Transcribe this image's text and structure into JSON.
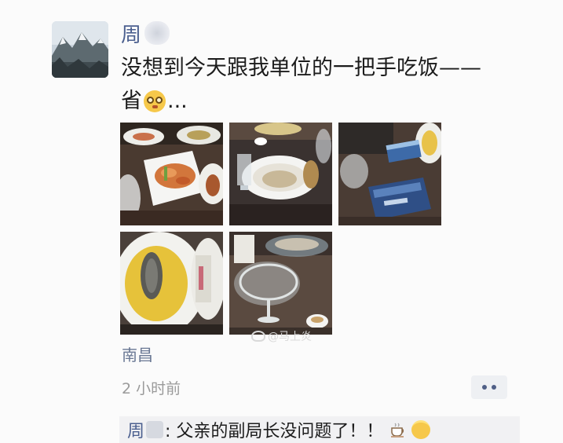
{
  "post": {
    "author_name": "周",
    "text_line1": "没想到今天跟我单位的一把手吃饭——",
    "text_line2_prefix": "省",
    "text_line2_suffix": "...",
    "emoji": "dizzy-face-emoji",
    "photos": [
      {
        "subject": "plated-shrimp-dishes"
      },
      {
        "subject": "soup-bowl-and-glasses"
      },
      {
        "subject": "cigarette-pack-on-table"
      },
      {
        "subject": "sea-cucumber-in-golden-broth"
      },
      {
        "subject": "wine-glass-and-tea-cups"
      }
    ],
    "location": "南昌",
    "time_ago": "2 小时前"
  },
  "watermark": {
    "text": "@马上炎"
  },
  "comment": {
    "author": "周",
    "text": ": 父亲的副局长没问题了！！",
    "emojis": [
      "coffee-icon",
      "angel-face-emoji"
    ]
  },
  "colors": {
    "name_blue": "#4b5f8f",
    "location_blue": "#6a7894",
    "time_gray": "#9a9a9a",
    "comment_bg": "#f1f1f3"
  }
}
